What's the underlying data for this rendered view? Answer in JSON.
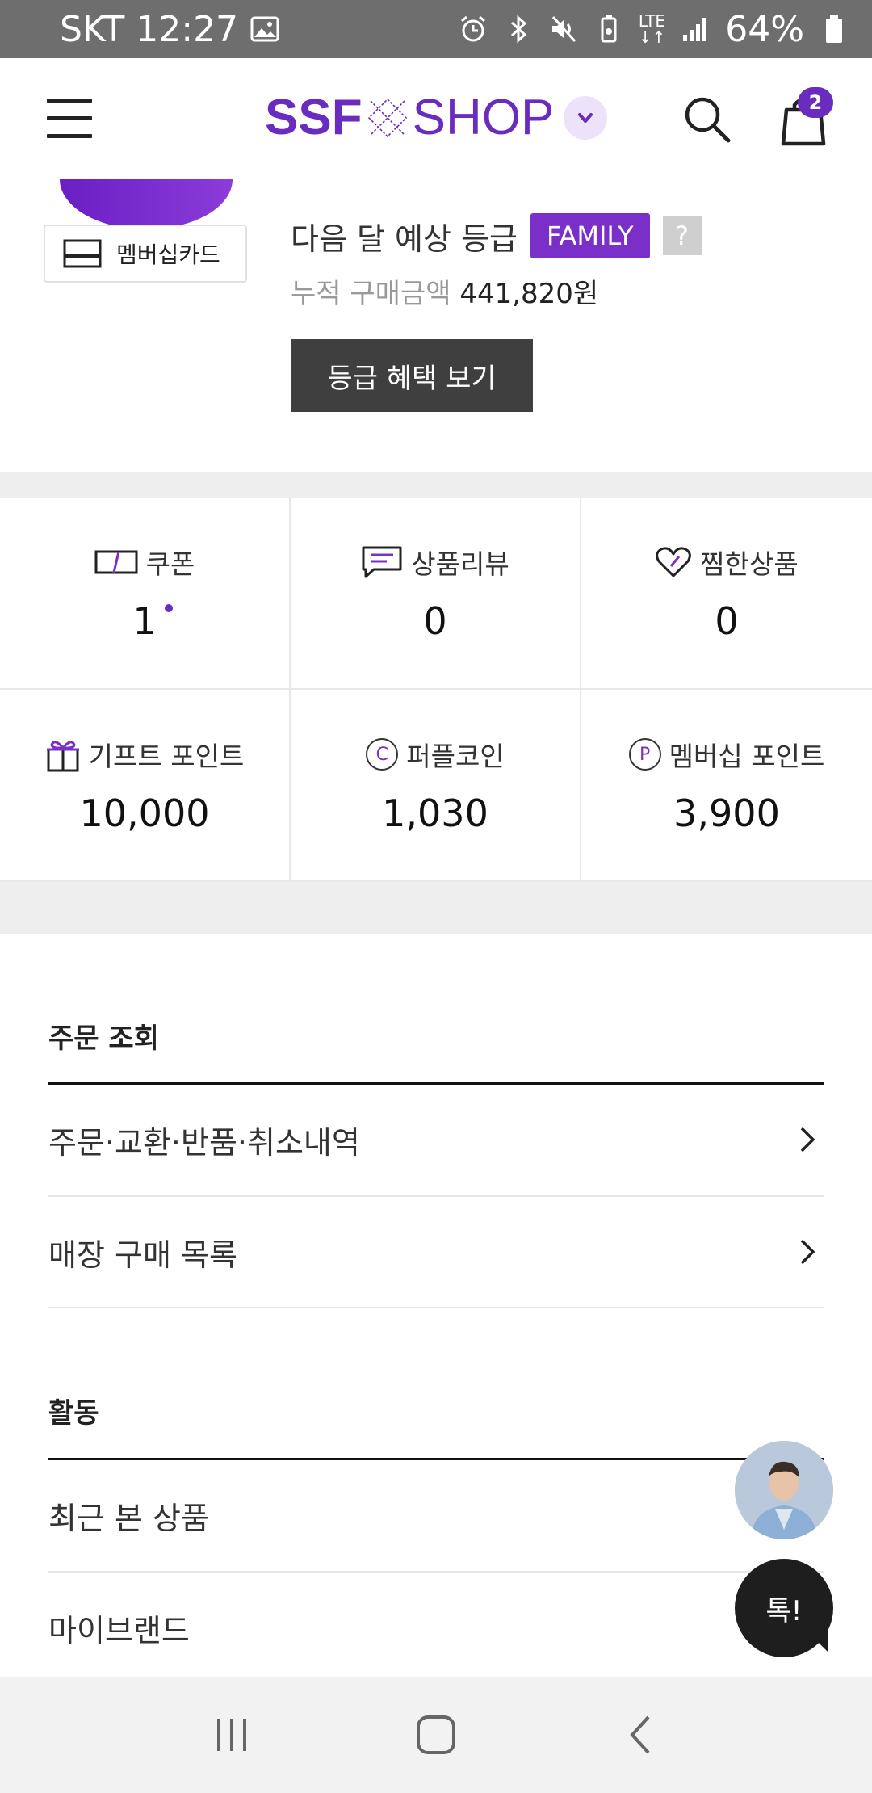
{
  "status_bar": {
    "carrier": "SKT",
    "time": "12:27",
    "network": "LTE",
    "battery": "64%"
  },
  "header": {
    "logo_left": "SSF",
    "logo_right": "SHOP",
    "cart_count": "2"
  },
  "profile": {
    "membership_card_label": "멤버십카드",
    "next_grade_label": "다음 달 예상 등급",
    "grade_badge": "FAMILY",
    "help_mark": "?",
    "cumulative_label": "누적 구매금액",
    "cumulative_amount": "441,820원",
    "benefit_button": "등급 혜택 보기"
  },
  "stats": [
    {
      "icon": "coupon-icon",
      "label": "쿠폰",
      "value": "1"
    },
    {
      "icon": "review-icon",
      "label": "상품리뷰",
      "value": "0"
    },
    {
      "icon": "heart-icon",
      "label": "찜한상품",
      "value": "0"
    },
    {
      "icon": "gift-icon",
      "label": "기프트 포인트",
      "value": "10,000"
    },
    {
      "icon": "coin-icon",
      "label": "퍼플코인",
      "value": "1,030",
      "glyph": "C"
    },
    {
      "icon": "point-icon",
      "label": "멤버십 포인트",
      "value": "3,900",
      "glyph": "P"
    }
  ],
  "sections": {
    "orders": {
      "title": "주문 조회",
      "items": [
        "주문·교환·반품·취소내역",
        "매장 구매 목록"
      ]
    },
    "activity": {
      "title": "활동",
      "items": [
        "최근 본 상품",
        "마이브랜드"
      ]
    }
  },
  "floating": {
    "talk_label": "톡!"
  },
  "colors": {
    "brand": "#6a2bbf",
    "badge": "#7a2fc8",
    "button_dark": "#3f3f3f"
  }
}
